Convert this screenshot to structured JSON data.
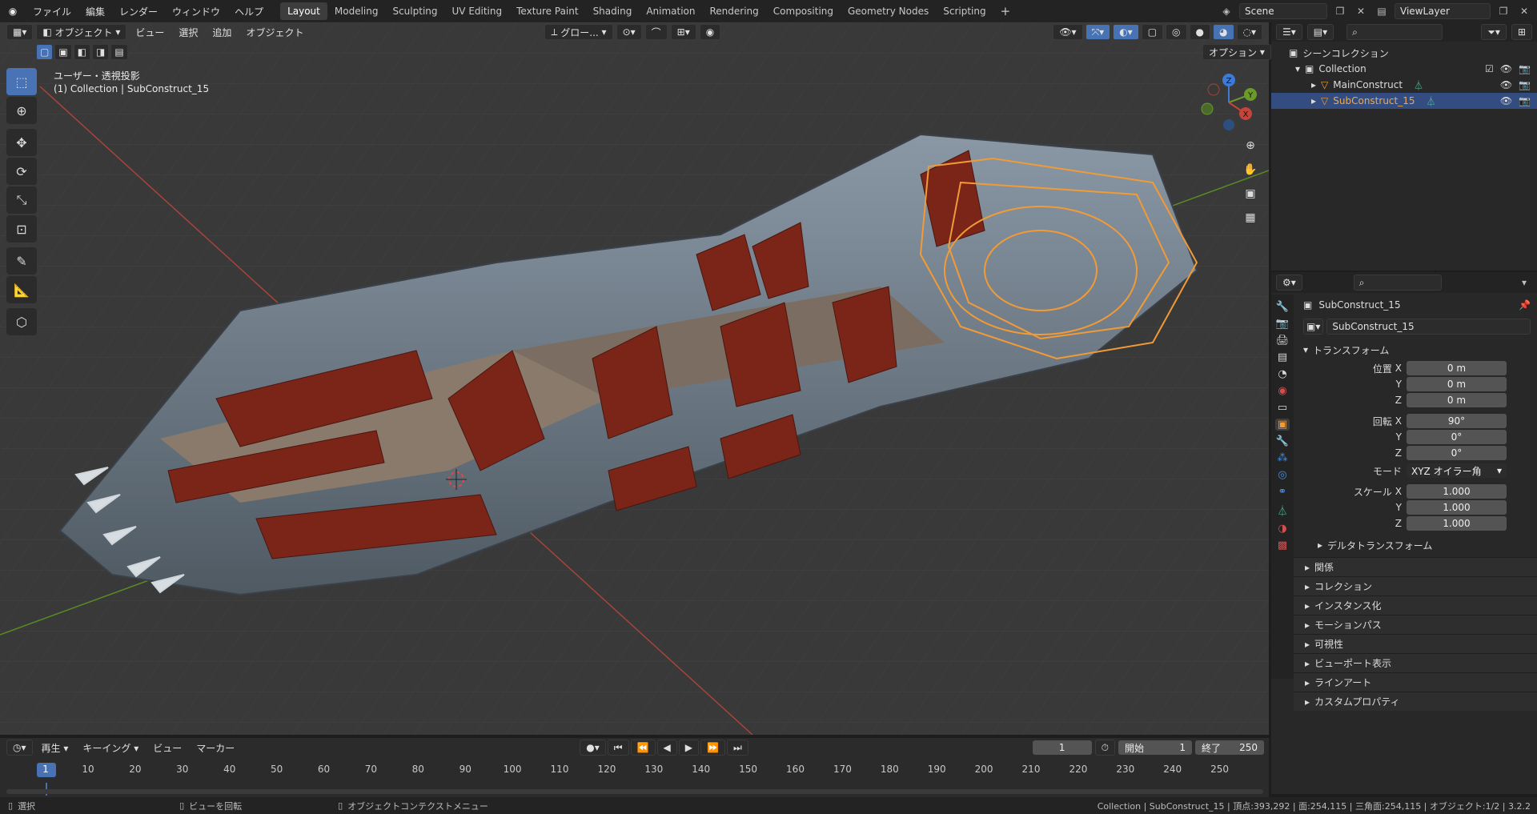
{
  "topbar": {
    "menus": [
      "ファイル",
      "編集",
      "レンダー",
      "ウィンドウ",
      "ヘルプ"
    ],
    "workspaces": [
      "Layout",
      "Modeling",
      "Sculpting",
      "UV Editing",
      "Texture Paint",
      "Shading",
      "Animation",
      "Rendering",
      "Compositing",
      "Geometry Nodes",
      "Scripting"
    ],
    "active_workspace": "Layout",
    "scene": "Scene",
    "viewlayer": "ViewLayer"
  },
  "viewport_header": {
    "mode": "オブジェクト",
    "menus": [
      "ビュー",
      "選択",
      "追加",
      "オブジェクト"
    ],
    "transform_orientation": "グロー...",
    "options": "オプション"
  },
  "viewport": {
    "view_name": "ユーザー・透視投影",
    "context": "(1) Collection | SubConstruct_15",
    "gizmo_axes": {
      "x": "X",
      "y": "Y",
      "z": "Z"
    }
  },
  "outliner": {
    "root": "シーンコレクション",
    "collection": "Collection",
    "items": [
      "MainConstruct",
      "SubConstruct_15"
    ],
    "selected": "SubConstruct_15"
  },
  "properties": {
    "object_name": "SubConstruct_15",
    "data_name": "SubConstruct_15",
    "transform_title": "トランスフォーム",
    "location": {
      "label": "位置",
      "x": "0 m",
      "y": "0 m",
      "z": "0 m"
    },
    "rotation": {
      "label": "回転",
      "x": "90°",
      "y": "0°",
      "z": "0°"
    },
    "mode_label": "モード",
    "mode_value": "XYZ オイラー角",
    "scale": {
      "label": "スケール",
      "x": "1.000",
      "y": "1.000",
      "z": "1.000"
    },
    "axis_labels": {
      "x": "X",
      "y": "Y",
      "z": "Z"
    },
    "delta": "デルタトランスフォーム",
    "panels": [
      "関係",
      "コレクション",
      "インスタンス化",
      "モーションパス",
      "可視性",
      "ビューポート表示",
      "ラインアート",
      "カスタムプロパティ"
    ]
  },
  "timeline": {
    "menus": [
      "再生",
      "キーイング",
      "ビュー",
      "マーカー"
    ],
    "current_frame": "1",
    "start_label": "開始",
    "start": "1",
    "end_label": "終了",
    "end": "250",
    "ticks": [
      "1",
      "10",
      "20",
      "30",
      "40",
      "50",
      "60",
      "70",
      "80",
      "90",
      "100",
      "110",
      "120",
      "130",
      "140",
      "150",
      "160",
      "170",
      "180",
      "190",
      "200",
      "210",
      "220",
      "230",
      "240",
      "250"
    ]
  },
  "statusbar": {
    "select": "選択",
    "rotate": "ビューを回転",
    "context_menu": "オブジェクトコンテクストメニュー",
    "stats": "Collection | SubConstruct_15 | 頂点:393,292 | 面:254,115 | 三角面:254,115 | オブジェクト:1/2 | 3.2.2"
  },
  "colors": {
    "accent": "#4772b3",
    "selection": "#f29b36",
    "x_axis": "#c4453a",
    "y_axis": "#6a9a2a",
    "z_axis": "#3d7bd6"
  }
}
